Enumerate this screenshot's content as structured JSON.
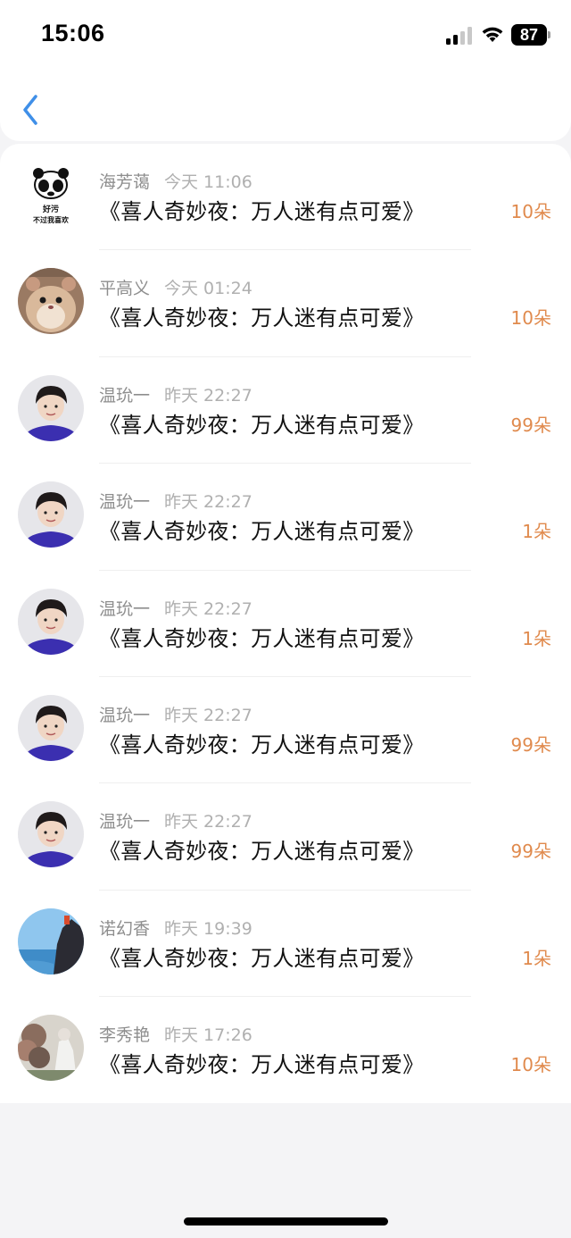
{
  "status_bar": {
    "time": "15:06",
    "battery": "87",
    "icons": [
      "signal-icon",
      "wifi-icon",
      "battery-icon"
    ]
  },
  "header": {
    "back_icon": "chevron-left-icon",
    "accent_color": "#3f8fe8"
  },
  "colors": {
    "gift_amount": "#e08a4d",
    "meta_text": "#9a9a9a",
    "title_text": "#111111"
  },
  "items": [
    {
      "name": "海芳蔼",
      "time": "今天 11:06",
      "title": "《喜人奇妙夜：万人迷有点可爱》",
      "amount": "10朵",
      "avatar": "panda-meme-avatar",
      "avatar_caption_top": "好污",
      "avatar_caption_bottom": "不过我喜欢"
    },
    {
      "name": "平高义",
      "time": "今天 01:24",
      "title": "《喜人奇妙夜：万人迷有点可爱》",
      "amount": "10朵",
      "avatar": "hamster-avatar"
    },
    {
      "name": "温玧一",
      "time": "昨天 22:27",
      "title": "《喜人奇妙夜：万人迷有点可爱》",
      "amount": "99朵",
      "avatar": "person-avatar"
    },
    {
      "name": "温玧一",
      "time": "昨天 22:27",
      "title": "《喜人奇妙夜：万人迷有点可爱》",
      "amount": "1朵",
      "avatar": "person-avatar"
    },
    {
      "name": "温玧一",
      "time": "昨天 22:27",
      "title": "《喜人奇妙夜：万人迷有点可爱》",
      "amount": "1朵",
      "avatar": "person-avatar"
    },
    {
      "name": "温玧一",
      "time": "昨天 22:27",
      "title": "《喜人奇妙夜：万人迷有点可爱》",
      "amount": "99朵",
      "avatar": "person-avatar"
    },
    {
      "name": "温玧一",
      "time": "昨天 22:27",
      "title": "《喜人奇妙夜：万人迷有点可爱》",
      "amount": "99朵",
      "avatar": "person-avatar"
    },
    {
      "name": "诺幻香",
      "time": "昨天 19:39",
      "title": "《喜人奇妙夜：万人迷有点可爱》",
      "amount": "1朵",
      "avatar": "seaside-avatar"
    },
    {
      "name": "李秀艳",
      "time": "昨天 17:26",
      "title": "《喜人奇妙夜：万人迷有点可爱》",
      "amount": "10朵",
      "avatar": "landscape-avatar"
    }
  ]
}
